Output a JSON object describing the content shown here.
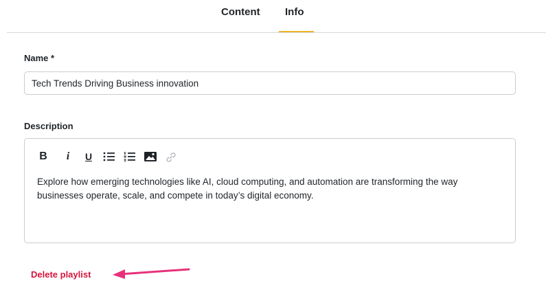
{
  "tabs": [
    {
      "label": "Content",
      "active": false
    },
    {
      "label": "Info",
      "active": true
    }
  ],
  "form": {
    "name_label": "Name *",
    "name_value": "Tech Trends Driving Business innovation",
    "description_label": "Description",
    "description_text": "Explore how emerging technologies like AI, cloud computing, and automation are transforming the way businesses operate, scale, and compete in today’s digital economy."
  },
  "toolbar": {
    "bold": "B",
    "italic": "i",
    "underline": "U",
    "icons": [
      "bulleted-list-icon",
      "numbered-list-icon",
      "image-icon",
      "link-icon"
    ]
  },
  "actions": {
    "delete_label": "Delete playlist"
  },
  "colors": {
    "accent_underline": "#f0b429",
    "danger": "#d4153b",
    "annotation_arrow": "#e8317a"
  }
}
